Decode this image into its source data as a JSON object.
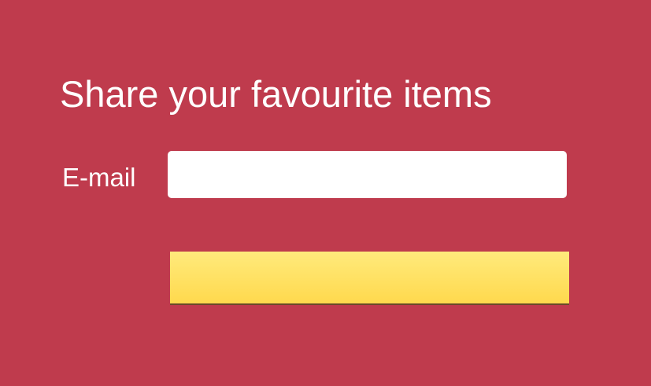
{
  "form": {
    "title": "Share your favourite items",
    "email_label": "E-mail",
    "email_value": "",
    "submit_label": ""
  },
  "colors": {
    "background": "#bf3b4d",
    "text": "#ffffff",
    "input_background": "#ffffff",
    "button_gradient_top": "#ffea7c",
    "button_gradient_bottom": "#ffd94d"
  }
}
